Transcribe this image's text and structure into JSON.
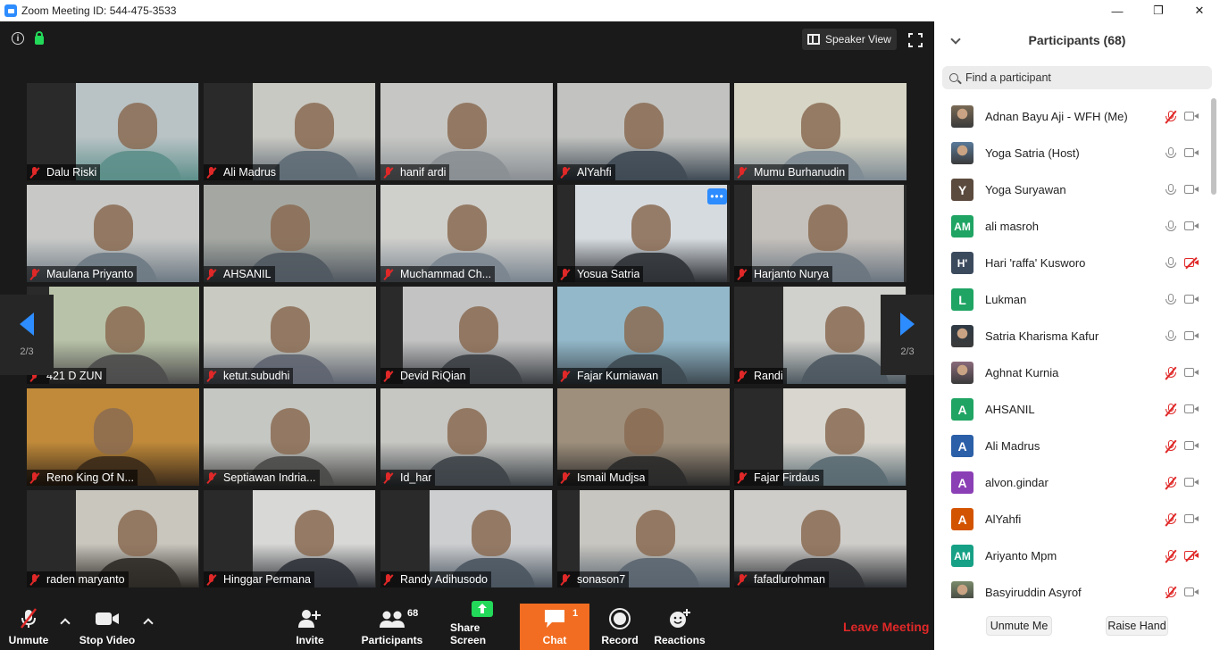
{
  "window": {
    "title": "Zoom Meeting ID: 544-475-3533",
    "controls": [
      "—",
      "❐",
      "✕"
    ]
  },
  "video": {
    "speaker_view_label": "Speaker View",
    "page_left": "2/3",
    "page_right": "2/3",
    "tiles": [
      {
        "name": "Dalu Riski",
        "bg": "#b9c3c6",
        "fg": "#5d8f8a"
      },
      {
        "name": "Ali Madrus",
        "bg": "#c9c9c3",
        "fg": "#5f6b75"
      },
      {
        "name": "hanif ardi",
        "bg": "#c6c7c4",
        "fg": "#8a8f94"
      },
      {
        "name": "AlYahfi",
        "bg": "#c2c3c0",
        "fg": "#3f4a55"
      },
      {
        "name": "Mumu Burhanudin",
        "bg": "#d7d5c6",
        "fg": "#7f8c95"
      },
      {
        "name": "Maulana Priyanto",
        "bg": "#c8c9c7",
        "fg": "#6e7a84"
      },
      {
        "name": "AHSANIL",
        "bg": "#a5a8a2",
        "fg": "#505860"
      },
      {
        "name": "Muchammad Ch...",
        "bg": "#cfcfcb",
        "fg": "#7a8590"
      },
      {
        "name": "Yosua Satria",
        "bg": "#d6dbe0",
        "fg": "#2f3236"
      },
      {
        "name": "Harjanto Nurya",
        "bg": "#c4c0bb",
        "fg": "#6a7580"
      },
      {
        "name": "421 D ZUN",
        "bg": "#b8c2a8",
        "fg": "#4d4d4d"
      },
      {
        "name": "ketut.subudhi",
        "bg": "#c9cac2",
        "fg": "#5e6470"
      },
      {
        "name": "Devid RiQian",
        "bg": "#c3c3c3",
        "fg": "#3b3f44"
      },
      {
        "name": "Fajar Kurniawan",
        "bg": "#93b8c9",
        "fg": "#3e4a52"
      },
      {
        "name": "Randi",
        "bg": "#d0d0cc",
        "fg": "#4c5860"
      },
      {
        "name": "Reno King Of N...",
        "bg": "#c08a3a",
        "fg": "#3a2a1a"
      },
      {
        "name": "Septiawan Indria...",
        "bg": "#c5c7c3",
        "fg": "#4a4a48"
      },
      {
        "name": "Id_har",
        "bg": "#c6c6c2",
        "fg": "#3d4348"
      },
      {
        "name": "Ismail Mudjsa",
        "bg": "#9e8f7c",
        "fg": "#2a2a2a"
      },
      {
        "name": "Fajar Firdaus",
        "bg": "#d8d6cf",
        "fg": "#5a6a72"
      },
      {
        "name": "raden maryanto",
        "bg": "#c9c6be",
        "fg": "#2e2a26"
      },
      {
        "name": "Hinggar Permana",
        "bg": "#d8d8d6",
        "fg": "#2f3238"
      },
      {
        "name": "Randy Adihusodo",
        "bg": "#cdced0",
        "fg": "#4a5560"
      },
      {
        "name": "sonason7",
        "bg": "#c8c6c0",
        "fg": "#5a6570"
      },
      {
        "name": "fafadlurohman",
        "bg": "#cfcdca",
        "fg": "#2c2f33"
      }
    ]
  },
  "toolbar": {
    "unmute": "Unmute",
    "stop_video": "Stop Video",
    "invite": "Invite",
    "participants": "Participants",
    "participants_count": "68",
    "share_screen": "Share Screen",
    "chat": "Chat",
    "chat_count": "1",
    "record": "Record",
    "reactions": "Reactions",
    "leave": "Leave Meeting"
  },
  "panel": {
    "title": "Participants (68)",
    "search_placeholder": "Find a participant",
    "participants": [
      {
        "name": "Adnan Bayu Aji - WFH (Me)",
        "avatar_type": "photo",
        "avatar_color": "#7a6a55",
        "initials": "",
        "mic_muted": true,
        "cam_off": false
      },
      {
        "name": "Yoga Satria (Host)",
        "avatar_type": "photo",
        "avatar_color": "#5a7a9a",
        "initials": "",
        "mic_muted": false,
        "cam_off": false
      },
      {
        "name": "Yoga Suryawan",
        "avatar_type": "letter",
        "avatar_color": "#5b4a3e",
        "initials": "Y",
        "mic_muted": false,
        "cam_off": false
      },
      {
        "name": "ali masroh",
        "avatar_type": "letter",
        "avatar_color": "#1fa463",
        "initials": "AM",
        "mic_muted": false,
        "cam_off": false
      },
      {
        "name": "Hari 'raffa' Kusworo",
        "avatar_type": "letter",
        "avatar_color": "#3c4a5e",
        "initials": "H'",
        "mic_muted": false,
        "cam_off": true
      },
      {
        "name": "Lukman",
        "avatar_type": "letter",
        "avatar_color": "#1fa463",
        "initials": "L",
        "mic_muted": false,
        "cam_off": false
      },
      {
        "name": "Satria Kharisma Kafur",
        "avatar_type": "photo",
        "avatar_color": "#2f3a45",
        "initials": "",
        "mic_muted": false,
        "cam_off": false
      },
      {
        "name": "Aghnat Kurnia",
        "avatar_type": "photo",
        "avatar_color": "#8a6a7a",
        "initials": "",
        "mic_muted": true,
        "cam_off": false
      },
      {
        "name": "AHSANIL",
        "avatar_type": "letter",
        "avatar_color": "#1fa463",
        "initials": "A",
        "mic_muted": true,
        "cam_off": false
      },
      {
        "name": "Ali Madrus",
        "avatar_type": "letter",
        "avatar_color": "#2b5fa8",
        "initials": "A",
        "mic_muted": true,
        "cam_off": false
      },
      {
        "name": "alvon.gindar",
        "avatar_type": "letter",
        "avatar_color": "#8b3fb5",
        "initials": "A",
        "mic_muted": true,
        "cam_off": false
      },
      {
        "name": "AlYahfi",
        "avatar_type": "letter",
        "avatar_color": "#d35400",
        "initials": "A",
        "mic_muted": true,
        "cam_off": false
      },
      {
        "name": "Ariyanto Mpm",
        "avatar_type": "letter",
        "avatar_color": "#16a085",
        "initials": "AM",
        "mic_muted": true,
        "cam_off": true
      },
      {
        "name": "Basyiruddin Asyrof",
        "avatar_type": "photo",
        "avatar_color": "#7a8a6a",
        "initials": "",
        "mic_muted": true,
        "cam_off": false
      }
    ],
    "unmute_me": "Unmute Me",
    "raise_hand": "Raise Hand"
  }
}
